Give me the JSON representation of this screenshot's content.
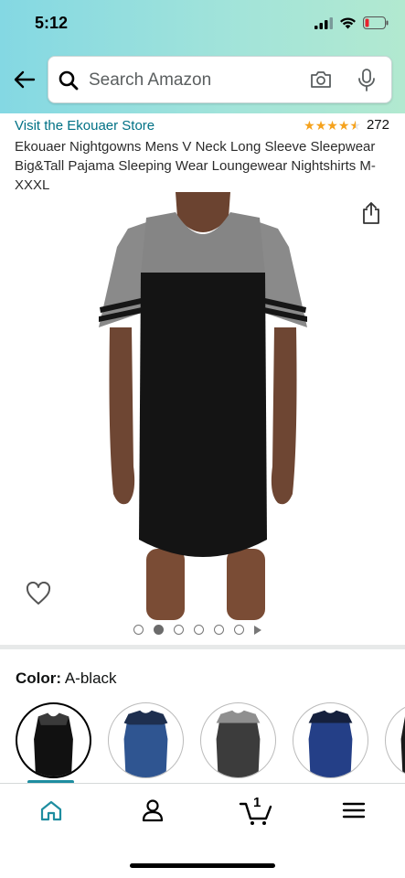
{
  "status_bar": {
    "time": "5:12"
  },
  "search": {
    "placeholder": "Search Amazon"
  },
  "product": {
    "store_link": "Visit the Ekouaer Store",
    "rating_count": "272",
    "rating_value": 4.5,
    "title": "Ekouaer Nightgowns Mens V Neck Long Sleeve Sleepwear Big&Tall Pajama Sleeping Wear Loungewear Nightshirts M-XXXL"
  },
  "gallery": {
    "image_count": 6,
    "active_index": 1
  },
  "color": {
    "label": "Color:",
    "selected": "A-black",
    "swatch_colors": [
      "#111111",
      "#2f5591",
      "#3c3c3c",
      "#243f87",
      "#1a1a1a"
    ]
  },
  "bottom_nav": {
    "cart_count": "1"
  },
  "colors": {
    "accent": "#1e8da0",
    "link": "#007185",
    "star": "#f5a21d"
  }
}
